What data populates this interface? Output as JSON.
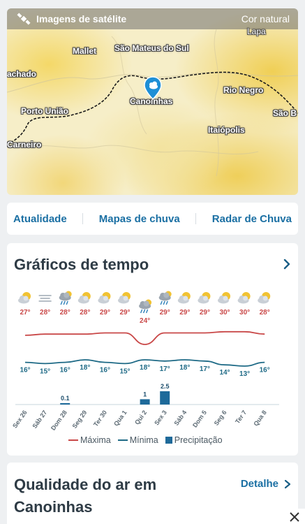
{
  "map": {
    "title": "Imagens de satélite",
    "mode": "Cor natural",
    "cities": [
      {
        "name": "Lapa"
      },
      {
        "name": "Mallet"
      },
      {
        "name": "São Mateus do Sul"
      },
      {
        "name": "achado"
      },
      {
        "name": "Canoinhas"
      },
      {
        "name": "Rio Negro"
      },
      {
        "name": "Porto União"
      },
      {
        "name": "São B"
      },
      {
        "name": "Itaiópolis"
      },
      {
        "name": "Carneiro"
      }
    ]
  },
  "links": {
    "item1": "Atualidade",
    "item2": "Mapas de chuva",
    "item3": "Radar de Chuva"
  },
  "charts": {
    "title": "Gráficos de tempo",
    "legend": {
      "max": "Máxima",
      "min": "Mínima",
      "precip": "Precipitação"
    },
    "colors": {
      "max": "#c94848",
      "min": "#1e6a86",
      "precip": "#1e6a9a"
    }
  },
  "chart_data": {
    "type": "line",
    "categories": [
      "Sex 26",
      "Sáb 27",
      "Dom 28",
      "Seg 29",
      "Ter 30",
      "Qua 1",
      "Qui 2",
      "Sex 3",
      "Sáb 4",
      "Dom 5",
      "Seg 6",
      "Ter 7",
      "Qua 8"
    ],
    "icons": [
      "sun-cloud-icon",
      "fog-icon",
      "rain-cloud-icon",
      "sun-cloud-icon",
      "sun-cloud-icon",
      "sun-cloud-icon",
      "rain-cloud-icon",
      "rain-cloud-icon",
      "sun-cloud-icon",
      "sun-cloud-icon",
      "sun-cloud-icon",
      "sun-cloud-icon",
      "sun-cloud-icon"
    ],
    "max_labels": [
      "27°",
      "28°",
      "28°",
      "28°",
      "29°",
      "29°",
      "24°",
      "29°",
      "29°",
      "29°",
      "30°",
      "30°",
      "28°"
    ],
    "min_labels": [
      "16°",
      "15°",
      "16°",
      "18°",
      "16°",
      "15°",
      "18°",
      "17°",
      "18°",
      "17°",
      "14°",
      "13°",
      "16°"
    ],
    "series": [
      {
        "name": "Máxima",
        "values": [
          27,
          28,
          28,
          28,
          29,
          29,
          24,
          29,
          29,
          29,
          30,
          30,
          28
        ]
      },
      {
        "name": "Mínima",
        "values": [
          16,
          15,
          16,
          18,
          16,
          15,
          18,
          17,
          18,
          17,
          14,
          13,
          16
        ]
      },
      {
        "name": "Precipitação",
        "values": [
          0,
          0,
          0.1,
          0,
          0,
          0,
          1,
          2.5,
          0,
          0,
          0,
          0,
          0
        ],
        "labels": [
          "",
          "",
          "0.1",
          "",
          "",
          "",
          "1",
          "2.5",
          "",
          "",
          "",
          "",
          ""
        ]
      }
    ]
  },
  "air": {
    "title": "Qualidade do ar em Canoinhas",
    "link": "Detalhe"
  }
}
